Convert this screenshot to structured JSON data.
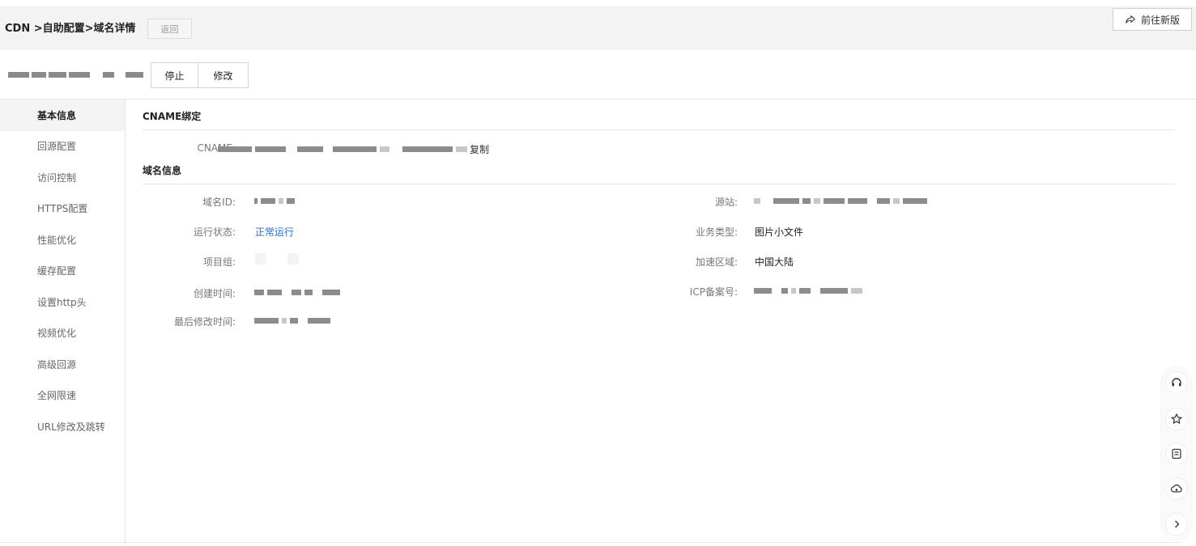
{
  "header": {
    "breadcrumb": "CDN >自助配置>域名详情",
    "back_label": "返回",
    "new_version_label": "前往新版"
  },
  "actions": {
    "stop_label": "停止",
    "edit_label": "修改"
  },
  "sidebar": {
    "items": [
      {
        "label": "基本信息"
      },
      {
        "label": "回源配置"
      },
      {
        "label": "访问控制"
      },
      {
        "label": "HTTPS配置"
      },
      {
        "label": "性能优化"
      },
      {
        "label": "缓存配置"
      },
      {
        "label": "设置http头"
      },
      {
        "label": "视频优化"
      },
      {
        "label": "高级回源"
      },
      {
        "label": "全网限速"
      },
      {
        "label": "URL修改及跳转"
      }
    ]
  },
  "cname_section": {
    "title": "CNAME绑定",
    "cname_label": "CNAME:",
    "copy_label": "复制"
  },
  "domain_section": {
    "title": "域名信息",
    "left": {
      "domain_id_label": "域名ID:",
      "status_label": "运行状态:",
      "status_value": "正常运行",
      "project_label": "项目组:",
      "created_label": "创建时间:",
      "modified_label": "最后修改时间:"
    },
    "right": {
      "origin_label": "源站:",
      "biz_type_label": "业务类型:",
      "biz_type_value": "图片小文件",
      "region_label": "加速区域:",
      "region_value": "中国大陆",
      "icp_label": "ICP备案号:"
    }
  },
  "colors": {
    "link": "#1f6fdc",
    "header_bg": "#f3f3f3"
  },
  "icons": {
    "new_version": "share-arrow-icon",
    "float": [
      "headset-icon",
      "star-icon",
      "document-icon",
      "cloud-icon",
      "chevron-right-icon"
    ]
  }
}
